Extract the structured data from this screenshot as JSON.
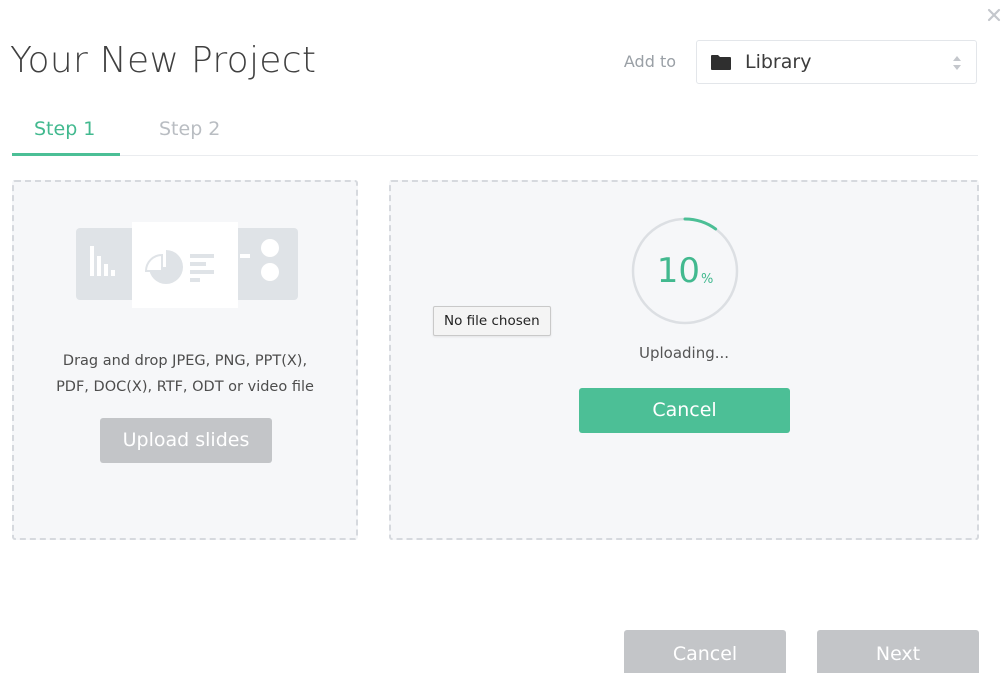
{
  "header": {
    "title": "Your New Project",
    "add_to_label": "Add to",
    "destination": {
      "icon": "folder-icon",
      "value": "Library"
    },
    "close_icon": "close-icon"
  },
  "tabs": [
    {
      "label": "Step 1",
      "active": true
    },
    {
      "label": "Step 2",
      "active": false
    }
  ],
  "upload_panel": {
    "illustration_icon": "slides-illustration-icon",
    "instructions_line1": "Drag and drop JPEG, PNG, PPT(X),",
    "instructions_line2": "PDF, DOC(X), RTF, ODT or video file",
    "upload_button": "Upload slides"
  },
  "progress_panel": {
    "percent": "10",
    "percent_unit": "%",
    "progress_fraction": 0.1,
    "status": "Uploading...",
    "cancel_button": "Cancel"
  },
  "file_tooltip": "No file chosen",
  "footer": {
    "cancel_button": "Cancel",
    "next_button": "Next"
  },
  "colors": {
    "accent": "#4cbf96",
    "disabled": "#c3c5c8",
    "panel_bg": "#f6f7f9"
  }
}
